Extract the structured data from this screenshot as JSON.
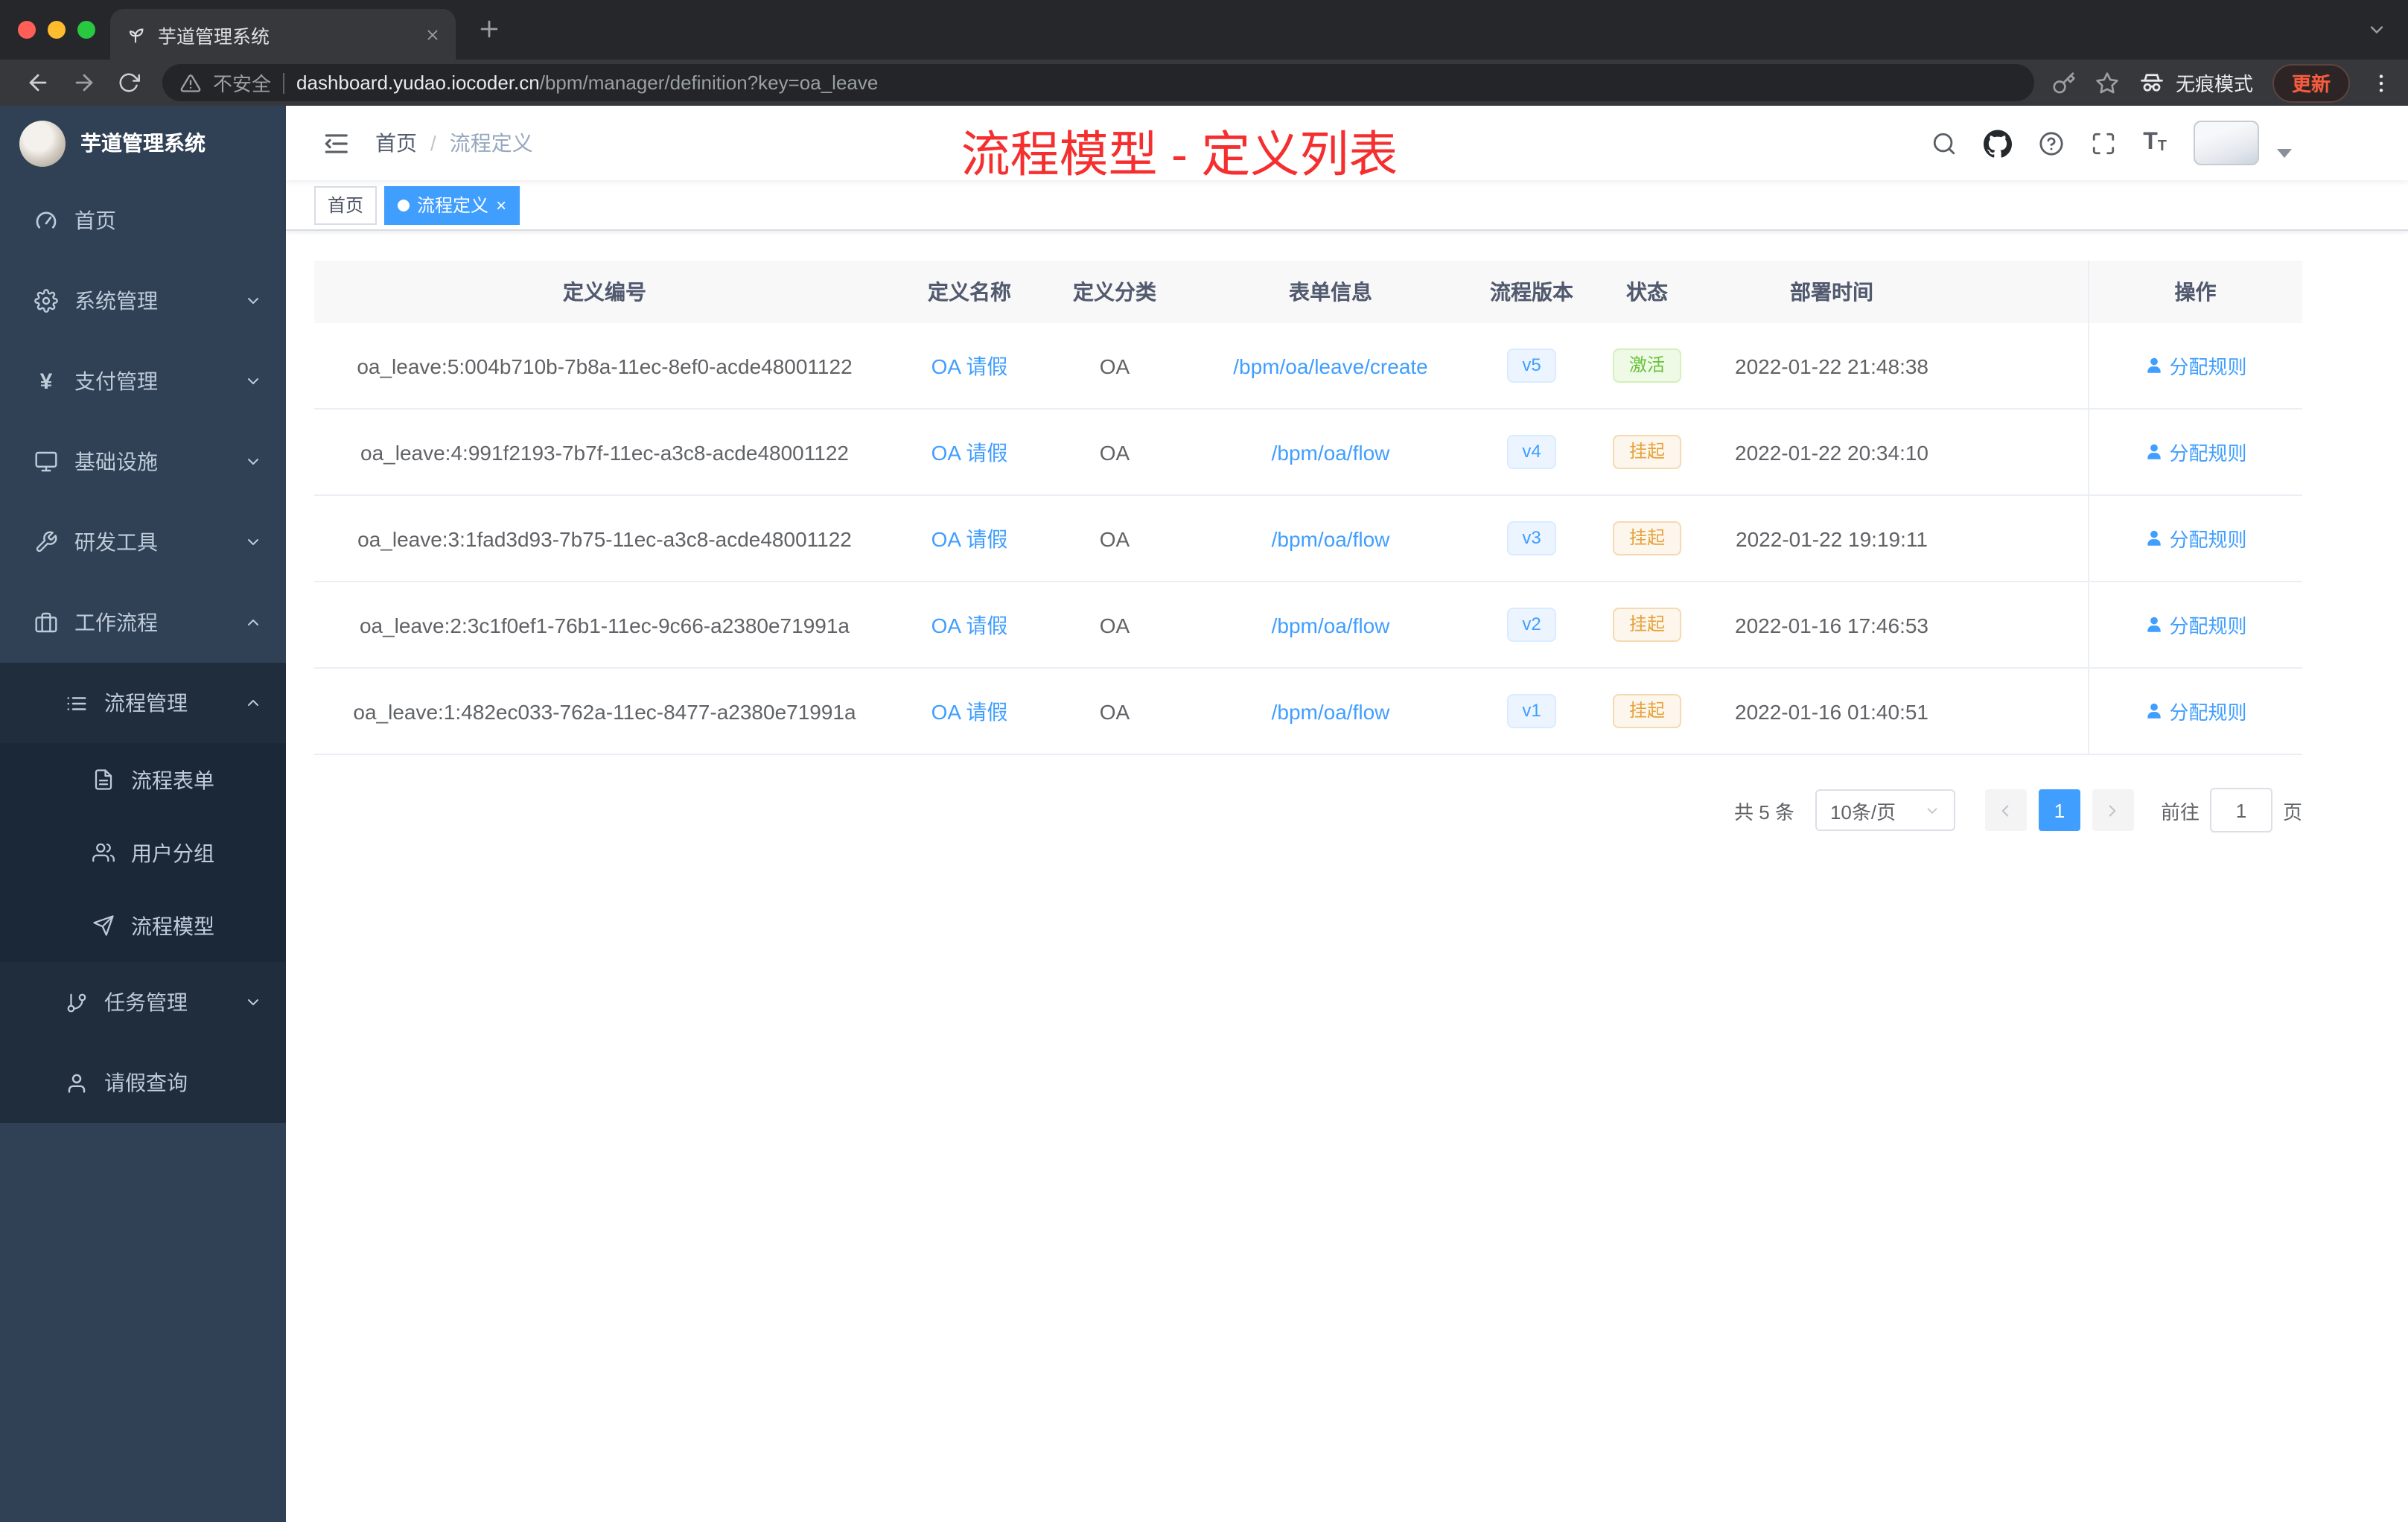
{
  "browser": {
    "tab_title": "芋道管理系统",
    "security_label": "不安全",
    "url_host": "dashboard.yudao.iocoder.cn",
    "url_path": "/bpm/manager/definition?key=oa_leave",
    "incognito_label": "无痕模式",
    "update_label": "更新"
  },
  "sidebar": {
    "logo_title": "芋道管理系统",
    "items": [
      {
        "label": "首页"
      },
      {
        "label": "系统管理"
      },
      {
        "label": "支付管理"
      },
      {
        "label": "基础设施"
      },
      {
        "label": "研发工具"
      },
      {
        "label": "工作流程"
      },
      {
        "label": "流程管理"
      },
      {
        "label": "流程表单"
      },
      {
        "label": "用户分组"
      },
      {
        "label": "流程模型"
      },
      {
        "label": "任务管理"
      },
      {
        "label": "请假查询"
      }
    ]
  },
  "header": {
    "breadcrumb_home": "首页",
    "breadcrumb_current": "流程定义",
    "annotation": "流程模型 - 定义列表"
  },
  "tags": {
    "home": "首页",
    "active": "流程定义"
  },
  "table": {
    "columns": [
      "定义编号",
      "定义名称",
      "定义分类",
      "表单信息",
      "流程版本",
      "状态",
      "部署时间",
      "操作"
    ],
    "rows": [
      {
        "id": "oa_leave:5:004b710b-7b8a-11ec-8ef0-acde48001122",
        "name": "OA 请假",
        "category": "OA",
        "form": "/bpm/oa/leave/create",
        "version": "v5",
        "status": "激活",
        "time": "2022-01-22 21:48:38",
        "action": "分配规则"
      },
      {
        "id": "oa_leave:4:991f2193-7b7f-11ec-a3c8-acde48001122",
        "name": "OA 请假",
        "category": "OA",
        "form": "/bpm/oa/flow",
        "version": "v4",
        "status": "挂起",
        "time": "2022-01-22 20:34:10",
        "action": "分配规则"
      },
      {
        "id": "oa_leave:3:1fad3d93-7b75-11ec-a3c8-acde48001122",
        "name": "OA 请假",
        "category": "OA",
        "form": "/bpm/oa/flow",
        "version": "v3",
        "status": "挂起",
        "time": "2022-01-22 19:19:11",
        "action": "分配规则"
      },
      {
        "id": "oa_leave:2:3c1f0ef1-76b1-11ec-9c66-a2380e71991a",
        "name": "OA 请假",
        "category": "OA",
        "form": "/bpm/oa/flow",
        "version": "v2",
        "status": "挂起",
        "time": "2022-01-16 17:46:53",
        "action": "分配规则"
      },
      {
        "id": "oa_leave:1:482ec033-762a-11ec-8477-a2380e71991a",
        "name": "OA 请假",
        "category": "OA",
        "form": "/bpm/oa/flow",
        "version": "v1",
        "status": "挂起",
        "time": "2022-01-16 01:40:51",
        "action": "分配规则"
      }
    ]
  },
  "pagination": {
    "total": "共 5 条",
    "page_size": "10条/页",
    "current_page": "1",
    "goto_label": "前往",
    "goto_value": "1",
    "page_unit": "页"
  },
  "colors": {
    "accent": "#409eff",
    "annotation_red": "#f52f2f",
    "sidebar_bg": "#304156",
    "status_active_green": "#67c23a",
    "status_suspend_orange": "#e6a23c"
  }
}
